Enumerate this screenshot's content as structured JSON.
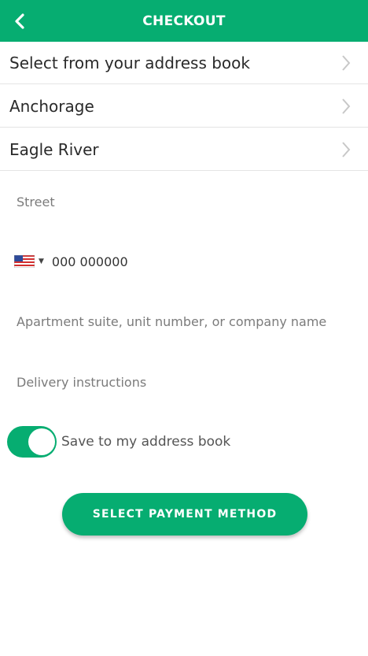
{
  "header": {
    "title": "CHECKOUT",
    "back_icon": "chevron-left-icon"
  },
  "address_rows": [
    {
      "label": "Select from your address book",
      "icon": "chevron-right-icon"
    },
    {
      "label": "Anchorage",
      "icon": "chevron-right-icon"
    },
    {
      "label": "Eagle River",
      "icon": "chevron-right-icon"
    }
  ],
  "form": {
    "street": {
      "placeholder": "Street",
      "value": ""
    },
    "phone": {
      "country_icon": "us-flag-icon",
      "placeholder": "000 000000",
      "value": ""
    },
    "apartment": {
      "placeholder": "Apartment suite, unit number, or company name",
      "value": ""
    },
    "instructions": {
      "placeholder": "Delivery instructions",
      "value": ""
    }
  },
  "save_toggle": {
    "label": "Save to my address book",
    "checked": true
  },
  "action": {
    "label": "SELECT PAYMENT METHOD"
  },
  "colors": {
    "accent": "#06ad71",
    "divider": "#e4e4e4",
    "chevron": "#c8c8c8"
  }
}
